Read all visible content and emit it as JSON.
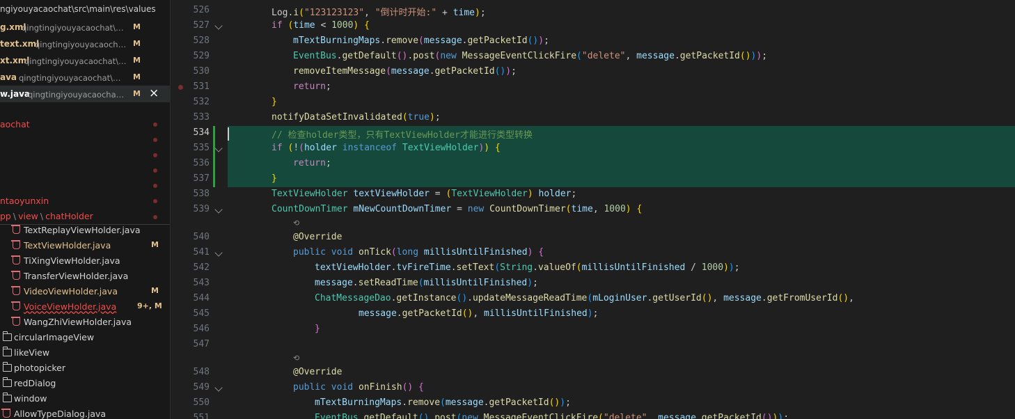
{
  "sidebar": {
    "path_header": "ngiyouyacaochat\\src\\main\\res\\values",
    "open_editors": [
      {
        "name": "g.xml",
        "desc": "qingtingiyouyacaochat\\src\\...",
        "mark": "M"
      },
      {
        "name": "text.xml",
        "desc": "qingtingiyouyacaochat\\...",
        "mark": "M"
      },
      {
        "name": "xt.xml",
        "desc": "qingtingiyouyacaochat\\src...",
        "mark": "M"
      },
      {
        "name": "ava",
        "desc": "qingtingiyouyacaochat\\src\\...",
        "mark": "M"
      },
      {
        "name": "w.java",
        "desc": "qingtingiyouyacaochat\\sr...",
        "mark": "M",
        "close": "×"
      }
    ],
    "project_rows": [
      {
        "label": "aochat"
      },
      {
        "label": ""
      },
      {
        "label": ""
      },
      {
        "label": ""
      },
      {
        "label": ""
      },
      {
        "label": "ntaoyunxin"
      }
    ],
    "breadcrumb": [
      "pp",
      "view",
      "chatHolder"
    ],
    "files": [
      {
        "name": "TextReplayViewHolder.java",
        "mark": ""
      },
      {
        "name": "TextViewHolder.java",
        "mark": "M"
      },
      {
        "name": "TiXingViewHolder.java",
        "mark": ""
      },
      {
        "name": "TransferViewHolder.java",
        "mark": ""
      },
      {
        "name": "VideoViewHolder.java",
        "mark": "M"
      },
      {
        "name": "VoiceViewHolder.java",
        "mark": "9+, M"
      },
      {
        "name": "WangZhiViewHolder.java",
        "mark": ""
      }
    ],
    "folders": [
      "circularImageView",
      "likeView",
      "photopicker",
      "redDialog",
      "window"
    ],
    "last_file": "AllowTypeDialog.java"
  },
  "editor": {
    "codelens": "⟲",
    "lines": [
      {
        "n": "526",
        "tokens": [
          [
            "pl",
            "Log."
          ],
          [
            "fn",
            "i"
          ],
          [
            "br1",
            "("
          ],
          [
            "st",
            "\"123123123\""
          ],
          [
            "pl",
            ", "
          ],
          [
            "st",
            "\"倒计时开始:\""
          ],
          [
            "pl",
            " + "
          ],
          [
            "vr",
            "time"
          ],
          [
            "br1",
            ")"
          ],
          [
            "pl",
            ";"
          ]
        ]
      },
      {
        "n": "527",
        "tokens": [
          [
            "kc",
            "if"
          ],
          [
            "pl",
            " "
          ],
          [
            "br1",
            "("
          ],
          [
            "vr",
            "time"
          ],
          [
            "pl",
            " < "
          ],
          [
            "nm2",
            "1000"
          ],
          [
            "br1",
            ")"
          ],
          [
            "pl",
            " "
          ],
          [
            "br1",
            "{"
          ]
        ]
      },
      {
        "n": "528",
        "tokens": [
          [
            "vr",
            "mTextBurningMaps"
          ],
          [
            "pl",
            "."
          ],
          [
            "fn",
            "remove"
          ],
          [
            "br2",
            "("
          ],
          [
            "vr",
            "message"
          ],
          [
            "pl",
            "."
          ],
          [
            "fn",
            "getPacketId"
          ],
          [
            "br3",
            "()"
          ],
          [
            "br2",
            ")"
          ],
          [
            "pl",
            ";"
          ]
        ]
      },
      {
        "n": "529",
        "tokens": [
          [
            "ty",
            "EventBus"
          ],
          [
            "pl",
            "."
          ],
          [
            "fn",
            "getDefault"
          ],
          [
            "br2",
            "()"
          ],
          [
            "pl",
            "."
          ],
          [
            "fn",
            "post"
          ],
          [
            "br2",
            "("
          ],
          [
            "kw",
            "new"
          ],
          [
            "pl",
            " "
          ],
          [
            "fn",
            "MessageEventClickFire"
          ],
          [
            "br3",
            "("
          ],
          [
            "st",
            "\"delete\""
          ],
          [
            "pl",
            ", "
          ],
          [
            "vr",
            "message"
          ],
          [
            "pl",
            "."
          ],
          [
            "fn",
            "getPacketId"
          ],
          [
            "br1",
            "()"
          ],
          [
            "br3",
            ")"
          ],
          [
            "br2",
            ")"
          ],
          [
            "pl",
            ";"
          ]
        ]
      },
      {
        "n": "530",
        "tokens": [
          [
            "fn",
            "removeItemMessage"
          ],
          [
            "br2",
            "("
          ],
          [
            "vr",
            "message"
          ],
          [
            "pl",
            "."
          ],
          [
            "fn",
            "getPacketId"
          ],
          [
            "br3",
            "()"
          ],
          [
            "br2",
            ")"
          ],
          [
            "pl",
            ";"
          ]
        ]
      },
      {
        "n": "531",
        "tokens": [
          [
            "kc",
            "return"
          ],
          [
            "pl",
            ";"
          ]
        ]
      },
      {
        "n": "532",
        "tokens": [
          [
            "br1",
            "}"
          ]
        ]
      },
      {
        "n": "533",
        "tokens": [
          [
            "fn",
            "notifyDataSetInvalidated"
          ],
          [
            "br1",
            "("
          ],
          [
            "kw",
            "true"
          ],
          [
            "br1",
            ")"
          ],
          [
            "pl",
            ";"
          ]
        ]
      },
      {
        "n": "534",
        "tokens": [
          [
            "cm",
            "// 检查holder类型，只有TextViewHolder才能进行类型转换"
          ]
        ]
      },
      {
        "n": "535",
        "tokens": [
          [
            "kc",
            "if"
          ],
          [
            "pl",
            " "
          ],
          [
            "br1",
            "("
          ],
          [
            "pl",
            "!"
          ],
          [
            "br2",
            "("
          ],
          [
            "vr",
            "holder"
          ],
          [
            "pl",
            " "
          ],
          [
            "kw",
            "instanceof"
          ],
          [
            "pl",
            " "
          ],
          [
            "ty",
            "TextViewHolder"
          ],
          [
            "br2",
            ")"
          ],
          [
            "br1",
            ")"
          ],
          [
            "pl",
            " "
          ],
          [
            "br1",
            "{"
          ]
        ]
      },
      {
        "n": "536",
        "tokens": [
          [
            "kc",
            "return"
          ],
          [
            "pl",
            ";"
          ]
        ]
      },
      {
        "n": "537",
        "tokens": [
          [
            "br1",
            "}"
          ]
        ]
      },
      {
        "n": "538",
        "tokens": [
          [
            "ty",
            "TextViewHolder"
          ],
          [
            "pl",
            " "
          ],
          [
            "vr",
            "textViewHolder"
          ],
          [
            "pl",
            " = "
          ],
          [
            "br1",
            "("
          ],
          [
            "ty",
            "TextViewHolder"
          ],
          [
            "br1",
            ")"
          ],
          [
            "pl",
            " "
          ],
          [
            "vr",
            "holder"
          ],
          [
            "pl",
            ";"
          ]
        ]
      },
      {
        "n": "539",
        "tokens": [
          [
            "ty",
            "CountDownTimer"
          ],
          [
            "pl",
            " "
          ],
          [
            "vr",
            "mNewCountDownTimer"
          ],
          [
            "pl",
            " = "
          ],
          [
            "kw",
            "new"
          ],
          [
            "pl",
            " "
          ],
          [
            "fn",
            "CountDownTimer"
          ],
          [
            "br1",
            "("
          ],
          [
            "vr",
            "time"
          ],
          [
            "pl",
            ", "
          ],
          [
            "nm2",
            "1000"
          ],
          [
            "br1",
            ")"
          ],
          [
            "pl",
            " "
          ],
          [
            "br1",
            "{"
          ]
        ]
      },
      {
        "n": "540",
        "tokens": [
          [
            "fn",
            "@Override"
          ]
        ]
      },
      {
        "n": "541",
        "tokens": [
          [
            "kw",
            "public"
          ],
          [
            "pl",
            " "
          ],
          [
            "kw",
            "void"
          ],
          [
            "pl",
            " "
          ],
          [
            "fn",
            "onTick"
          ],
          [
            "br2",
            "("
          ],
          [
            "kw",
            "long"
          ],
          [
            "pl",
            " "
          ],
          [
            "vr",
            "millisUntilFinished"
          ],
          [
            "br2",
            ")"
          ],
          [
            "pl",
            " "
          ],
          [
            "br2",
            "{"
          ]
        ]
      },
      {
        "n": "542",
        "tokens": [
          [
            "vr",
            "textViewHolder"
          ],
          [
            "pl",
            "."
          ],
          [
            "vr",
            "tvFireTime"
          ],
          [
            "pl",
            "."
          ],
          [
            "fn",
            "setText"
          ],
          [
            "br3",
            "("
          ],
          [
            "ty",
            "String"
          ],
          [
            "pl",
            "."
          ],
          [
            "fn",
            "valueOf"
          ],
          [
            "br1",
            "("
          ],
          [
            "vr",
            "millisUntilFinished"
          ],
          [
            "pl",
            " / "
          ],
          [
            "nm2",
            "1000"
          ],
          [
            "br1",
            ")"
          ],
          [
            "br3",
            ")"
          ],
          [
            "pl",
            ";"
          ]
        ]
      },
      {
        "n": "543",
        "tokens": [
          [
            "vr",
            "message"
          ],
          [
            "pl",
            "."
          ],
          [
            "fn",
            "setReadTime"
          ],
          [
            "br3",
            "("
          ],
          [
            "vr",
            "millisUntilFinished"
          ],
          [
            "br3",
            ")"
          ],
          [
            "pl",
            ";"
          ]
        ]
      },
      {
        "n": "544",
        "tokens": [
          [
            "ty",
            "ChatMessageDao"
          ],
          [
            "pl",
            "."
          ],
          [
            "fn",
            "getInstance"
          ],
          [
            "br3",
            "()"
          ],
          [
            "pl",
            "."
          ],
          [
            "fn",
            "updateMessageReadTime"
          ],
          [
            "br3",
            "("
          ],
          [
            "vr",
            "mLoginUser"
          ],
          [
            "pl",
            "."
          ],
          [
            "fn",
            "getUserId"
          ],
          [
            "br1",
            "()"
          ],
          [
            "pl",
            ", "
          ],
          [
            "vr",
            "message"
          ],
          [
            "pl",
            "."
          ],
          [
            "fn",
            "getFromUserId"
          ],
          [
            "br1",
            "()"
          ],
          [
            "pl",
            ","
          ]
        ]
      },
      {
        "n": "545",
        "tokens": [
          [
            "vr",
            "message"
          ],
          [
            "pl",
            "."
          ],
          [
            "fn",
            "getPacketId"
          ],
          [
            "br1",
            "()"
          ],
          [
            "pl",
            ", "
          ],
          [
            "vr",
            "millisUntilFinished"
          ],
          [
            "br3",
            ")"
          ],
          [
            "pl",
            ";"
          ]
        ]
      },
      {
        "n": "546",
        "tokens": [
          [
            "br2",
            "}"
          ]
        ]
      },
      {
        "n": "547",
        "tokens": []
      },
      {
        "n": "548",
        "tokens": [
          [
            "fn",
            "@Override"
          ]
        ]
      },
      {
        "n": "549",
        "tokens": [
          [
            "kw",
            "public"
          ],
          [
            "pl",
            " "
          ],
          [
            "kw",
            "void"
          ],
          [
            "pl",
            " "
          ],
          [
            "fn",
            "onFinish"
          ],
          [
            "br2",
            "()"
          ],
          [
            "pl",
            " "
          ],
          [
            "br2",
            "{"
          ]
        ]
      },
      {
        "n": "550",
        "tokens": [
          [
            "vr",
            "mTextBurningMaps"
          ],
          [
            "pl",
            "."
          ],
          [
            "fn",
            "remove"
          ],
          [
            "br3",
            "("
          ],
          [
            "vr",
            "message"
          ],
          [
            "pl",
            "."
          ],
          [
            "fn",
            "getPacketId"
          ],
          [
            "br1",
            "()"
          ],
          [
            "br3",
            ")"
          ],
          [
            "pl",
            ";"
          ]
        ]
      },
      {
        "n": "551",
        "tokens": [
          [
            "ty",
            "EventBus"
          ],
          [
            "pl",
            "."
          ],
          [
            "fn",
            "getDefault"
          ],
          [
            "br3",
            "()"
          ],
          [
            "pl",
            "."
          ],
          [
            "fn",
            "post"
          ],
          [
            "br3",
            "("
          ],
          [
            "kw",
            "new"
          ],
          [
            "pl",
            " "
          ],
          [
            "fn",
            "MessageEventClickFire"
          ],
          [
            "br1",
            "("
          ],
          [
            "st",
            "\"delete\""
          ],
          [
            "pl",
            ", "
          ],
          [
            "vr",
            "message"
          ],
          [
            "pl",
            "."
          ],
          [
            "fn",
            "getPacketId"
          ],
          [
            "br2",
            "()"
          ],
          [
            "br1",
            ")"
          ],
          [
            "br3",
            ")"
          ],
          [
            "pl",
            ";"
          ]
        ]
      }
    ]
  }
}
